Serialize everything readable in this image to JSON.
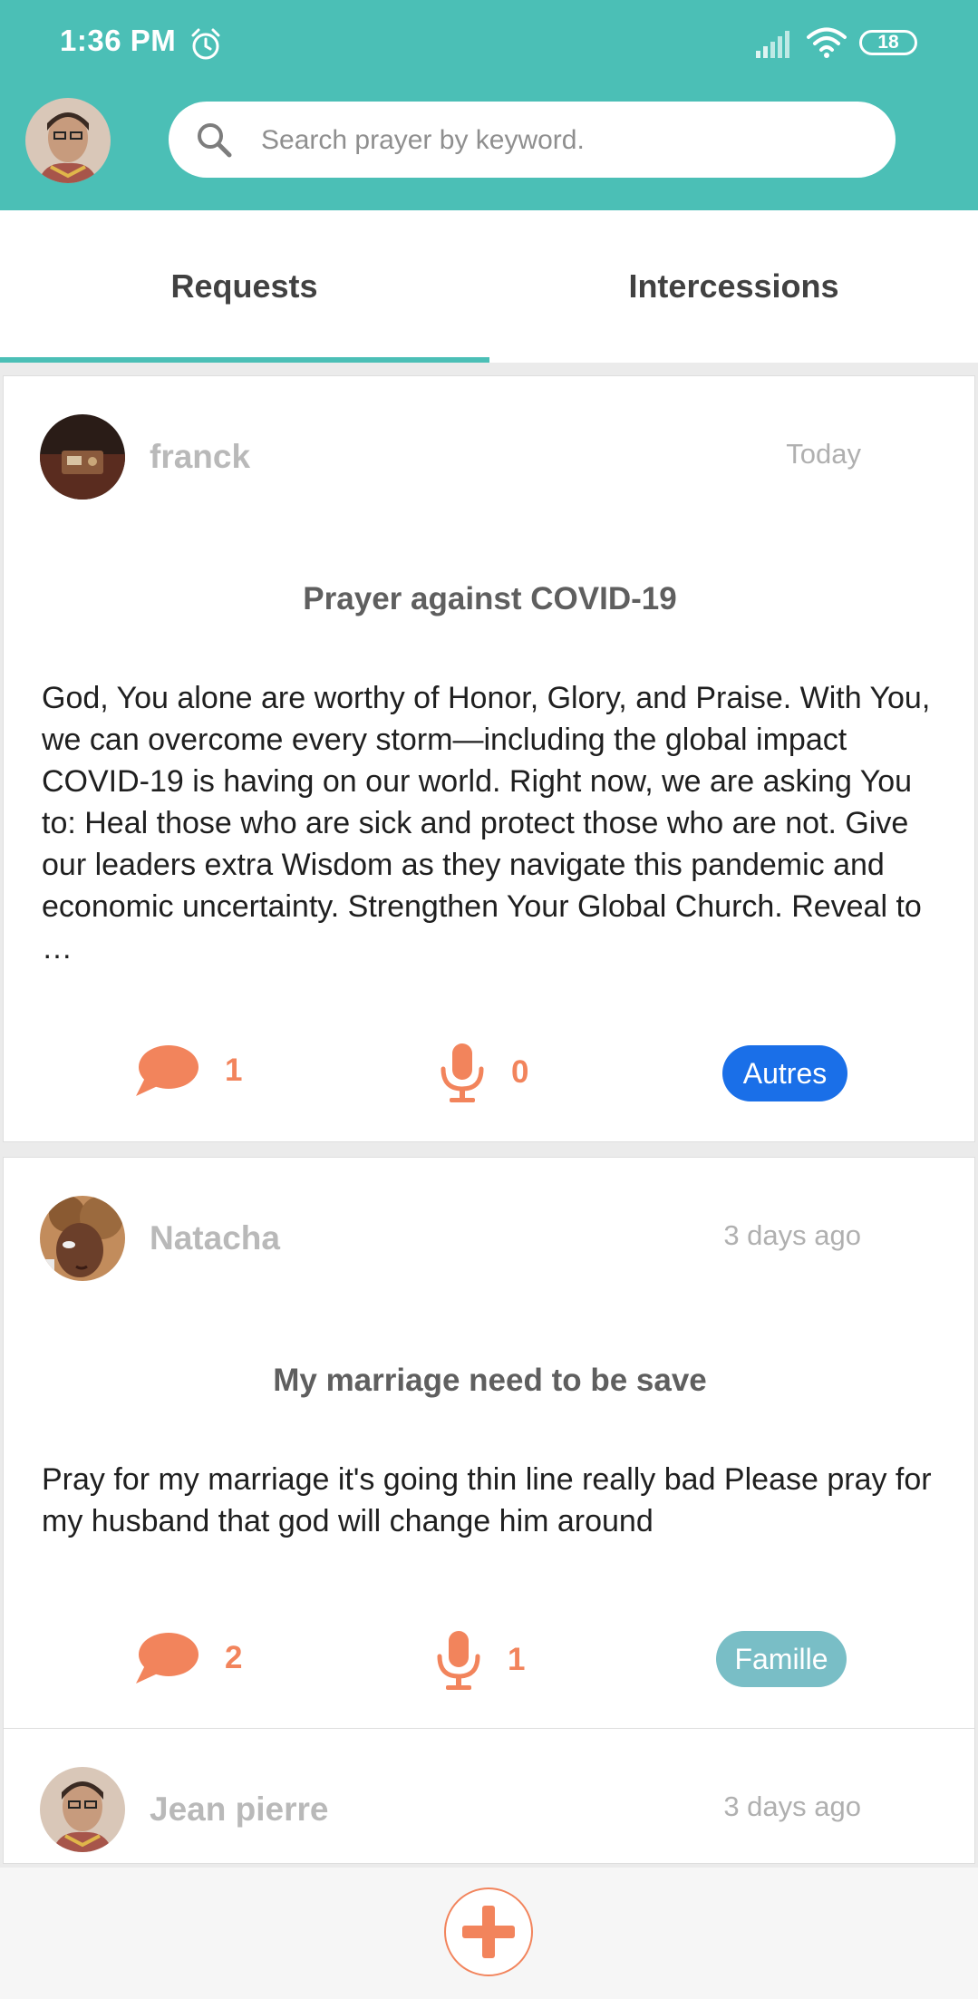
{
  "status_bar": {
    "time": "1:36 PM",
    "battery": "18"
  },
  "search": {
    "placeholder": "Search prayer by keyword."
  },
  "tabs": [
    {
      "label": "Requests",
      "active": true
    },
    {
      "label": "Intercessions",
      "active": false
    }
  ],
  "colors": {
    "accent": "#4bbfb6",
    "action": "#f2845c",
    "badge_autres": "#1a6fe8",
    "badge_famille": "#79bec6"
  },
  "posts": [
    {
      "author": "franck",
      "time": "Today",
      "title": "Prayer against COVID-19",
      "body": "God, You alone are worthy of Honor, Glory, and Praise. With You, we can overcome every storm—including the global impact COVID-19 is having on our world. Right now, we are asking You to:  Heal those who are sick and protect those who are not.  Give our leaders extra Wisdom as they navigate this pandemic and economic uncertainty.  Strengthen Your Global Church. Reveal to …",
      "comments": "1",
      "recordings": "0",
      "category": "Autres"
    },
    {
      "author": "Natacha",
      "time": "3 days ago",
      "title": "My marriage need to be save",
      "body": "Pray for my marriage it's going thin line really bad Please pray for my husband that god will change him around",
      "comments": "2",
      "recordings": "1",
      "category": "Famille"
    },
    {
      "author": "Jean pierre",
      "time": "3 days ago"
    }
  ]
}
